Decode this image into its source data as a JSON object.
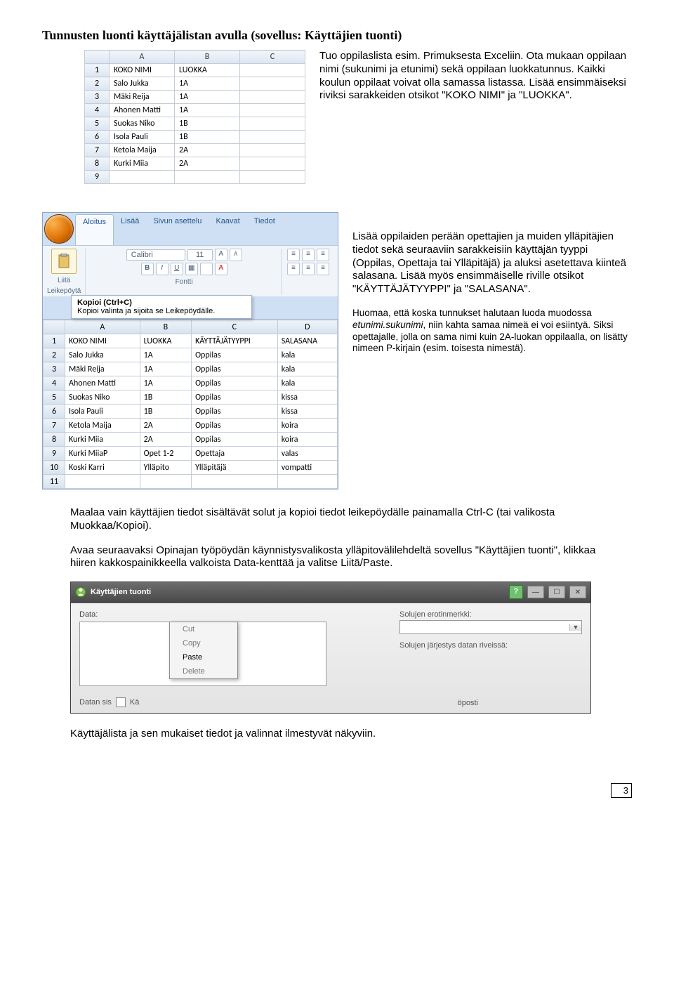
{
  "heading": "Tunnusten luonti käyttäjälistan avulla (sovellus: Käyttäjien tuonti)",
  "para1": "Tuo oppilaslista esim. Primuksesta Exceliin. Ota mukaan oppilaan nimi (sukunimi ja etunimi) sekä oppilaan luokkatunnus. Kaikki koulun oppilaat voivat olla samassa listassa. Lisää ensimmäiseksi riviksi sarakkeiden otsikot \"KOKO NIMI\" ja \"LUOKKA\".",
  "para2": "Lisää oppilaiden perään opettajien ja muiden ylläpitäjien tiedot sekä seuraaviin sarakkeisiin käyttäjän tyyppi (Oppilas, Opettaja tai Ylläpitäjä) ja aluksi asetettava kiinteä salasana. Lisää myös ensimmäiselle riville otsikot \"KÄYTTÄJÄTYYPPI\" ja \"SALASANA\".",
  "para3_a": "Huomaa, että koska tunnukset halutaan luoda muodossa ",
  "para3_i": "etunimi.sukunimi",
  "para3_b": ", niin kahta samaa nimeä ei voi esiintyä. Siksi opettajalle, jolla on sama nimi kuin 2A-luokan oppilaalla, on lisätty nimeen P-kirjain (esim. toisesta nimestä).",
  "para4": "Maalaa vain käyttäjien tiedot sisältävät solut ja kopioi tiedot leikepöydälle painamalla Ctrl-C (tai valikosta Muokkaa/Kopioi).",
  "para5": "Avaa seuraavaksi Opinajan työpöydän käynnistysvalikosta ylläpitovälilehdeltä sovellus \"Käyttäjien tuonti\", klikkaa hiiren kakkospainikkeella valkoista Data-kenttää ja valitse Liitä/Paste.",
  "para6": "Käyttäjälista ja sen mukaiset tiedot ja valinnat ilmestyvät näkyviin.",
  "page_number": "3",
  "xls1": {
    "cols": [
      "A",
      "B",
      "C"
    ],
    "rows": [
      [
        "1",
        "KOKO NIMI",
        "LUOKKA",
        ""
      ],
      [
        "2",
        "Salo Jukka",
        "1A",
        ""
      ],
      [
        "3",
        "Mäki Reija",
        "1A",
        ""
      ],
      [
        "4",
        "Ahonen Matti",
        "1A",
        ""
      ],
      [
        "5",
        "Suokas Niko",
        "1B",
        ""
      ],
      [
        "6",
        "Isola Pauli",
        "1B",
        ""
      ],
      [
        "7",
        "Ketola Maija",
        "2A",
        ""
      ],
      [
        "8",
        "Kurki Miia",
        "2A",
        ""
      ],
      [
        "9",
        "",
        "",
        ""
      ]
    ]
  },
  "ribbon": {
    "tabs": [
      "Aloitus",
      "Lisää",
      "Sivun asettelu",
      "Kaavat",
      "Tiedot"
    ],
    "active_tab": "Aloitus",
    "paste_label": "Liitä",
    "clipboard_group": "Leikepöytä",
    "font_name": "Calibri",
    "font_size": "11",
    "font_group": "Fontti",
    "tooltip_title": "Kopioi (Ctrl+C)",
    "tooltip_body": "Kopioi valinta ja sijoita se Leikepöydälle."
  },
  "chart_data": {
    "type": "table",
    "title": "Käyttäjälista (Excel)",
    "columns": [
      "KOKO NIMI",
      "LUOKKA",
      "KÄYTTÄJÄTYYPPI",
      "SALASANA"
    ],
    "rows": [
      [
        "Salo Jukka",
        "1A",
        "Oppilas",
        "kala"
      ],
      [
        "Mäki Reija",
        "1A",
        "Oppilas",
        "kala"
      ],
      [
        "Ahonen Matti",
        "1A",
        "Oppilas",
        "kala"
      ],
      [
        "Suokas Niko",
        "1B",
        "Oppilas",
        "kissa"
      ],
      [
        "Isola Pauli",
        "1B",
        "Oppilas",
        "kissa"
      ],
      [
        "Ketola Maija",
        "2A",
        "Oppilas",
        "koira"
      ],
      [
        "Kurki Miia",
        "2A",
        "Oppilas",
        "koira"
      ],
      [
        "Kurki MiiaP",
        "Opet 1-2",
        "Opettaja",
        "valas"
      ],
      [
        "Koski Karri",
        "Ylläpito",
        "Ylläpitäjä",
        "vompatti"
      ]
    ]
  },
  "app": {
    "title": "Käyttäjien tuonti",
    "data_label": "Data:",
    "ctx": [
      "Cut",
      "Copy",
      "Paste",
      "Delete"
    ],
    "ctx_enabled": "Paste",
    "sep_label": "Solujen erotinmerkki:",
    "order_label": "Solujen järjestys datan riveissä:",
    "lower_left": "Datan sis",
    "lower_chk_label": "Kä",
    "lower_right": "öposti"
  }
}
